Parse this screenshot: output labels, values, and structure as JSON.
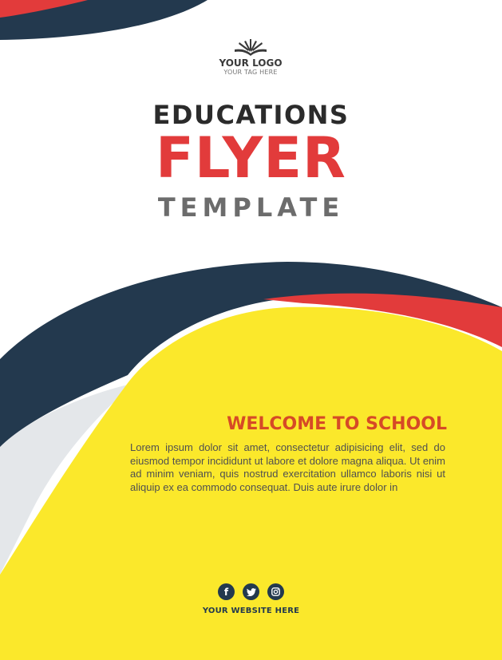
{
  "logo": {
    "name": "YOUR LOGO",
    "tagline": "YOUR TAG HERE"
  },
  "title": {
    "line1": "EDUCATIONS",
    "line2": "FLYER",
    "line3": "TEMPLATE"
  },
  "content": {
    "heading": "WELCOME TO SCHOOL",
    "body": "Lorem ipsum dolor sit amet, consectetur adipisicing elit, sed do eiusmod tempor incididunt ut labore et dolore magna aliqua. Ut enim ad minim veniam, quis nostrud exercitation ullamco laboris nisi ut aliquip ex ea commodo consequat. Duis aute irure dolor in"
  },
  "footer": {
    "social_icons": [
      "facebook-icon",
      "twitter-icon",
      "instagram-icon"
    ],
    "website": "YOUR WEBSITE HERE"
  },
  "colors": {
    "navy": "#23394e",
    "yellow": "#fbe82b",
    "red": "#e23b3b",
    "heading_orange": "#d64a26",
    "light_gray": "#e8eaed"
  }
}
